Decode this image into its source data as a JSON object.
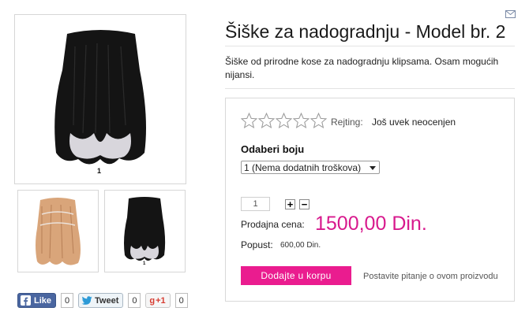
{
  "product": {
    "title": "Šiške za nadogradnju - Model br. 2",
    "description": "Šiške od prirodne kose za nadogradnju klipsama. Osam mogućih nijansi.",
    "main_image_number": "1",
    "thumb_image_number": "1"
  },
  "rating": {
    "label": "Rejting:",
    "value": "Još uvek neocenjen",
    "stars_total": 5,
    "stars_filled": 0
  },
  "color": {
    "label": "Odaberi boju",
    "selected": "1 (Nema dodatnih troškova)"
  },
  "quantity": {
    "value": "1",
    "plus": "+",
    "minus": "−"
  },
  "price": {
    "label": "Prodajna cena:",
    "value": "1500,00 Din."
  },
  "discount": {
    "label": "Popust:",
    "value": "600,00 Din."
  },
  "actions": {
    "add_to_cart": "Dodajte u korpu",
    "ask_question": "Postavite pitanje o ovom proizvodu"
  },
  "social": {
    "facebook_label": "Like",
    "facebook_count": "0",
    "twitter_label": "Tweet",
    "twitter_count": "0",
    "gplus_label": "+1",
    "gplus_count": "0"
  },
  "colors": {
    "accent": "#ea1c8f",
    "price": "#d8198d",
    "facebook": "#4a66a0"
  },
  "icons": [
    "hair-image",
    "facebook-icon",
    "twitter-icon",
    "google-plus-icon",
    "star-icon",
    "email-icon"
  ]
}
